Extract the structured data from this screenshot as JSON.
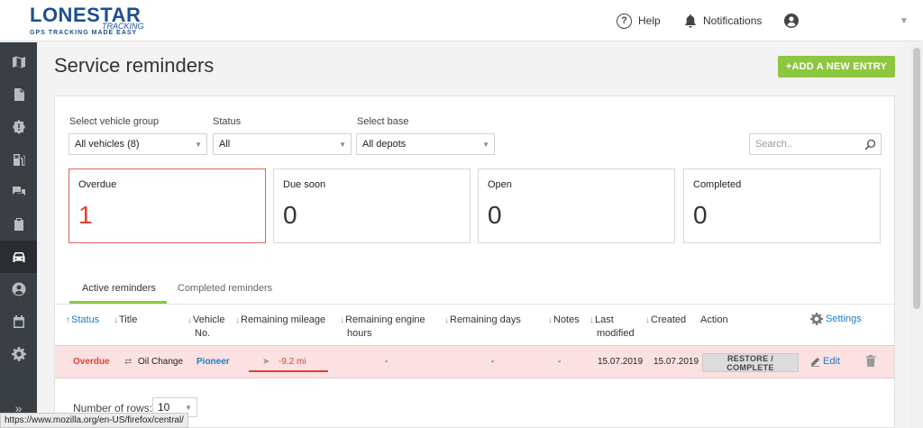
{
  "header": {
    "logo_main": "LONESTAR",
    "logo_sub": "TRACKING",
    "logo_tag": "GPS TRACKING MADE EASY",
    "help": "Help",
    "notifications": "Notifications"
  },
  "page": {
    "title": "Service reminders",
    "add_button": "+ADD A NEW ENTRY"
  },
  "filters": {
    "vehicle_group_label": "Select vehicle group",
    "vehicle_group_value": "All vehicles (8)",
    "status_label": "Status",
    "status_value": "All",
    "base_label": "Select base",
    "base_value": "All depots",
    "search_placeholder": "Search.."
  },
  "cards": [
    {
      "label": "Overdue",
      "count": "1"
    },
    {
      "label": "Due soon",
      "count": "0"
    },
    {
      "label": "Open",
      "count": "0"
    },
    {
      "label": "Completed",
      "count": "0"
    }
  ],
  "tabs": [
    {
      "label": "Active reminders"
    },
    {
      "label": "Completed reminders"
    }
  ],
  "table": {
    "headers": {
      "status": "Status",
      "title": "Title",
      "vehicle_no_1": "Vehicle",
      "vehicle_no_2": "No.",
      "remaining_mileage": "Remaining mileage",
      "remaining_engine_1": "Remaining engine",
      "remaining_engine_2": "hours",
      "remaining_days": "Remaining days",
      "notes": "Notes",
      "last_modified_1": "Last",
      "last_modified_2": "modified",
      "created": "Created",
      "action": "Action",
      "settings": "Settings"
    },
    "rows": [
      {
        "status": "Overdue",
        "title": "Oil Change",
        "vehicle": "Pioneer",
        "remaining_mileage": "-9.2 mi",
        "remaining_engine_hours": "-",
        "remaining_days": "-",
        "notes": "-",
        "last_modified": "15.07.2019",
        "created": "15.07.2019",
        "action": "RESTORE / COMPLETE",
        "edit": "Edit"
      }
    ]
  },
  "pagination": {
    "rows_label": "Number of rows:",
    "rows_value": "10"
  },
  "statusbar": {
    "url": "https://www.mozilla.org/en-US/firefox/central/"
  },
  "colors": {
    "accent_green": "#8dc63f",
    "link_blue": "#1a7cc7",
    "overdue_red": "#e23d36",
    "sidebar": "#3a3f44"
  }
}
